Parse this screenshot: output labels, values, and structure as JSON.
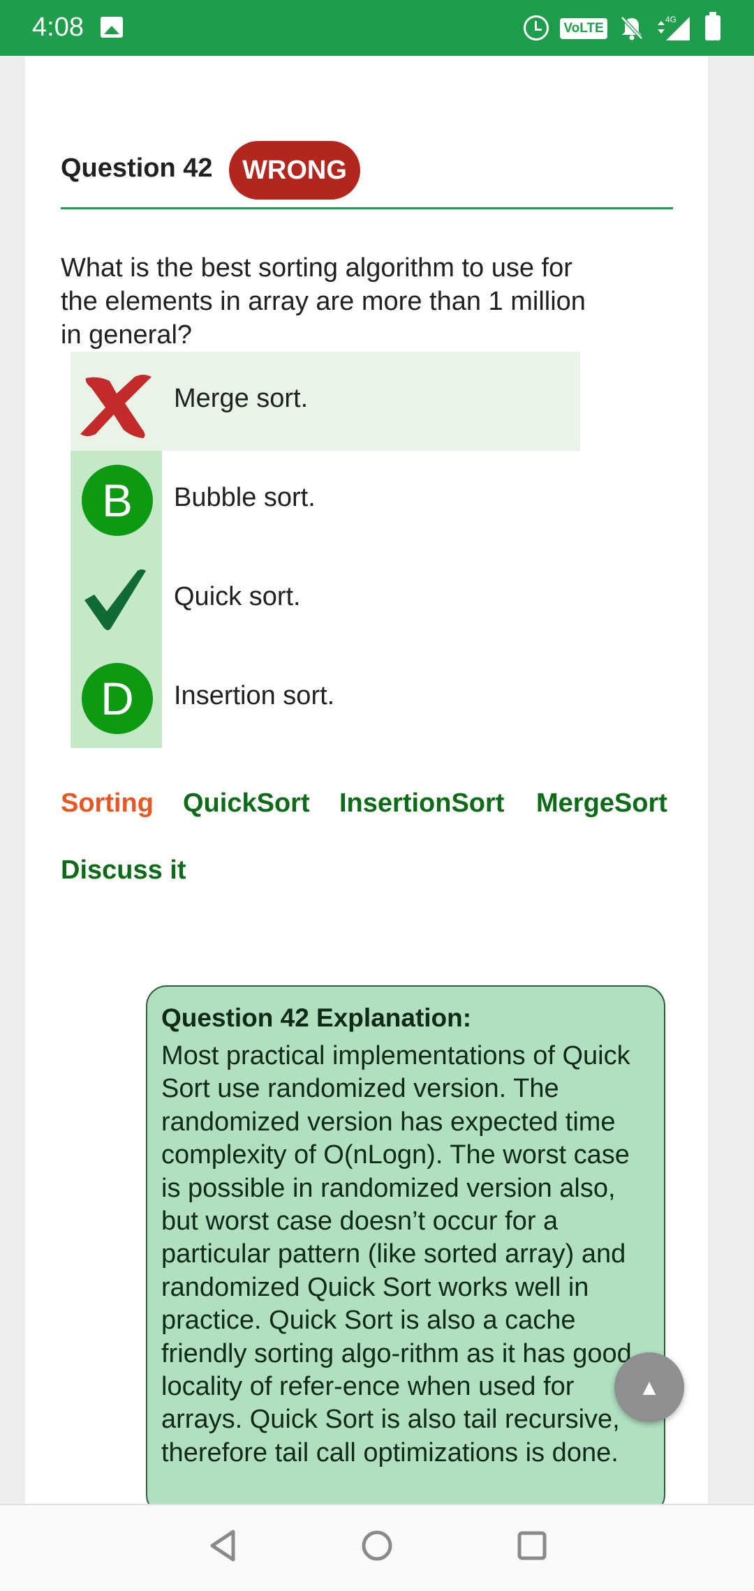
{
  "status_bar": {
    "time": "4:08",
    "network_badge": "VoLTE",
    "signal_label": "4G"
  },
  "question": {
    "title": "Question 42",
    "result_badge": "WRONG",
    "text": "What is the best sorting algorithm to use for the elements in array are more than 1 million in general?"
  },
  "options": [
    {
      "label": "Merge sort.",
      "marker": "wrong-x-icon",
      "selected": true
    },
    {
      "label": "Bubble sort.",
      "marker": "B"
    },
    {
      "label": "Quick sort.",
      "marker": "checkmark-icon",
      "correct": true
    },
    {
      "label": "Insertion sort.",
      "marker": "D"
    }
  ],
  "tags": [
    "Sorting",
    "QuickSort",
    "InsertionSort",
    "MergeSort"
  ],
  "discuss_label": "Discuss it",
  "explanation": {
    "title": "Question 42 Explanation:",
    "body": "Most practical implementations of Quick Sort use randomized version. The randomized version has expected time complexity of O(nLogn). The worst case is possible in randomized version also, but worst case doesn’t occur for a particular pattern (like sorted array) and randomized Quick Sort works well in practice. Quick Sort is also a cache friendly sorting algo-rithm as it has good locality of refer-ence when used for arrays. Quick Sort is also tail recursive, therefore tail call optimizations is done."
  },
  "scroll_top_icon": "▲",
  "colors": {
    "status_bar": "#1e9e4a",
    "wrong_badge": "#b3261e",
    "tag_active": "#e55723",
    "tag": "#0b6b16",
    "explanation_bg": "#b0e0c0"
  }
}
